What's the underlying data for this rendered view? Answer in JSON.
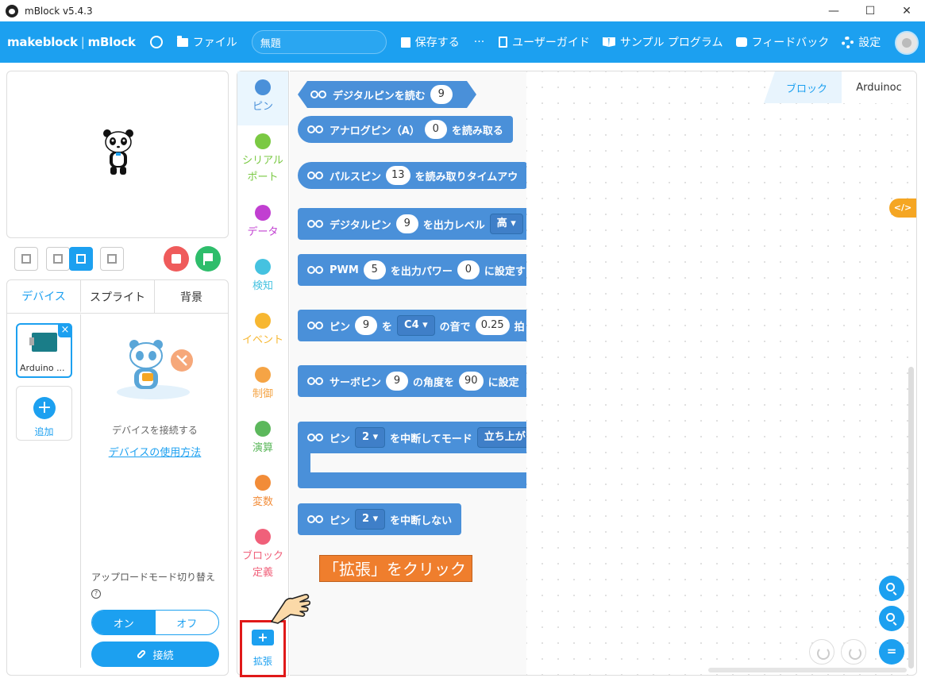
{
  "window": {
    "title": "mBlock v5.4.3",
    "minimize": "—",
    "maximize": "☐",
    "close": "✕"
  },
  "menubar": {
    "logo": "makeblock",
    "logo_product": "mBlock",
    "file": "ファイル",
    "project_title": "無題",
    "save": "保存する",
    "more": "···",
    "user_guide": "ユーザーガイド",
    "sample": "サンプル プログラム",
    "feedback": "フィードバック",
    "settings": "設定"
  },
  "device_panel": {
    "tabs": [
      "デバイス",
      "スプライト",
      "背景"
    ],
    "device_name": "Arduino ...",
    "add_label": "追加",
    "connect_hint": "デバイスを接続する",
    "usage_link": "デバイスの使用方法",
    "upload_mode_label": "アップロードモード切り替え",
    "help": "?",
    "toggle_on": "オン",
    "toggle_off": "オフ",
    "connect_button": "接続"
  },
  "categories": [
    {
      "label": "ピン",
      "color": "#4a90d9"
    },
    {
      "label": "シリアル\nポート",
      "color": "#7ac943"
    },
    {
      "label": "データ",
      "color": "#c13fd1"
    },
    {
      "label": "検知",
      "color": "#45c2e0"
    },
    {
      "label": "イベント",
      "color": "#f7b731"
    },
    {
      "label": "制御",
      "color": "#f5a445"
    },
    {
      "label": "演算",
      "color": "#5cb85c"
    },
    {
      "label": "変数",
      "color": "#f28c38"
    },
    {
      "label": "ブロック\n定義",
      "color": "#f0607a"
    }
  ],
  "extension": {
    "plus": "+",
    "label": "拡張"
  },
  "blocks": {
    "b1": {
      "text": "デジタルピンを読む",
      "v1": "9"
    },
    "b2": {
      "t1": "アナログピン（A）",
      "v1": "0",
      "t2": "を読み取る"
    },
    "b3": {
      "t1": "パルスピン",
      "v1": "13",
      "t2": "を読み取りタイムアウ"
    },
    "b4": {
      "t1": "デジタルピン",
      "v1": "9",
      "t2": "を出力レベル",
      "dd": "高 ▾"
    },
    "b5": {
      "t1": "PWM",
      "v1": "5",
      "t2": "を出力パワー",
      "v2": "0",
      "t3": "に設定す"
    },
    "b6": {
      "t1": "ピン",
      "v1": "9",
      "t2": "を",
      "dd": "C4 ▾",
      "t3": "の音で",
      "v2": "0.25",
      "t4": "拍"
    },
    "b7": {
      "t1": "サーボピン",
      "v1": "9",
      "t2": "の角度を",
      "v2": "90",
      "t3": "に設定"
    },
    "b8": {
      "t1": "ピン",
      "dd": "2 ▾",
      "t2": "を中断してモード",
      "dd2": "立ち上が"
    },
    "b9": {
      "t1": "ピン",
      "dd": "2 ▾",
      "t2": "を中断しない"
    }
  },
  "script_area": {
    "tab_blocks": "ブロック",
    "tab_code": "Arduinoc",
    "code_toggle": "</>"
  },
  "annotation": {
    "callout": "「拡張」をクリック"
  }
}
